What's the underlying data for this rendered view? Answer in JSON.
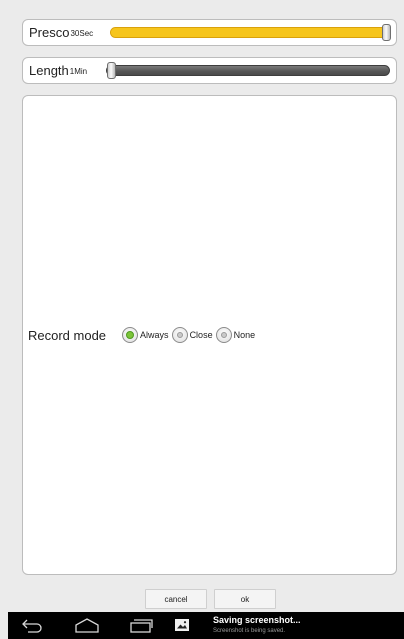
{
  "presco": {
    "label": "Presco",
    "unit": "30Sec",
    "level": 1.0
  },
  "length": {
    "label": "Length",
    "unit": "1Min",
    "level": 0.0
  },
  "record_mode": {
    "label": "Record mode",
    "options": [
      {
        "label": "Always",
        "selected": true
      },
      {
        "label": "Close",
        "selected": false
      },
      {
        "label": "None",
        "selected": false
      }
    ]
  },
  "buttons": {
    "cancel": "cancel",
    "ok": "ok"
  },
  "notification": {
    "title": "Saving screenshot...",
    "subtitle": "Screenshot is being saved."
  },
  "colors": {
    "accent": "#f5c21a",
    "radio_selected": "#7cc439"
  },
  "icons": [
    "back-icon",
    "home-icon",
    "recent-apps-icon",
    "screenshot-icon"
  ]
}
